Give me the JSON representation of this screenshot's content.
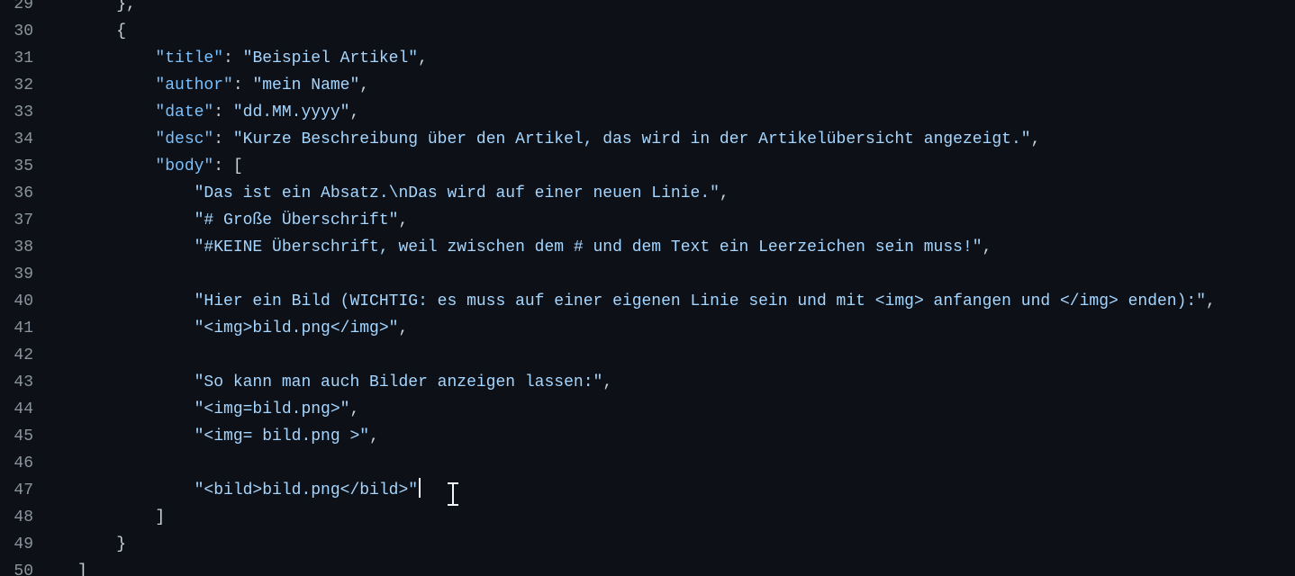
{
  "editor": {
    "lines": [
      {
        "num": "29",
        "pre": "    },",
        "key": "",
        "mid": "",
        "str": "",
        "post": ""
      },
      {
        "num": "30",
        "pre": "    {",
        "key": "",
        "mid": "",
        "str": "",
        "post": ""
      },
      {
        "num": "31",
        "pre": "        ",
        "key": "\"title\"",
        "mid": ": ",
        "str": "\"Beispiel Artikel\"",
        "post": ","
      },
      {
        "num": "32",
        "pre": "        ",
        "key": "\"author\"",
        "mid": ": ",
        "str": "\"mein Name\"",
        "post": ","
      },
      {
        "num": "33",
        "pre": "        ",
        "key": "\"date\"",
        "mid": ": ",
        "str": "\"dd.MM.yyyy\"",
        "post": ","
      },
      {
        "num": "34",
        "pre": "        ",
        "key": "\"desc\"",
        "mid": ": ",
        "str": "\"Kurze Beschreibung über den Artikel, das wird in der Artikelübersicht angezeigt.\"",
        "post": ","
      },
      {
        "num": "35",
        "pre": "        ",
        "key": "\"body\"",
        "mid": ": [",
        "str": "",
        "post": ""
      },
      {
        "num": "36",
        "pre": "            ",
        "key": "",
        "mid": "",
        "str": "\"Das ist ein Absatz.\\nDas wird auf einer neuen Linie.\"",
        "post": ","
      },
      {
        "num": "37",
        "pre": "            ",
        "key": "",
        "mid": "",
        "str": "\"# Große Überschrift\"",
        "post": ","
      },
      {
        "num": "38",
        "pre": "            ",
        "key": "",
        "mid": "",
        "str": "\"#KEINE Überschrift, weil zwischen dem # und dem Text ein Leerzeichen sein muss!\"",
        "post": ","
      },
      {
        "num": "39",
        "pre": "",
        "key": "",
        "mid": "",
        "str": "",
        "post": ""
      },
      {
        "num": "40",
        "pre": "            ",
        "key": "",
        "mid": "",
        "str": "\"Hier ein Bild (WICHTIG: es muss auf einer eigenen Linie sein und mit <img> anfangen und </img> enden):\"",
        "post": ","
      },
      {
        "num": "41",
        "pre": "            ",
        "key": "",
        "mid": "",
        "str": "\"<img>bild.png</img>\"",
        "post": ","
      },
      {
        "num": "42",
        "pre": "",
        "key": "",
        "mid": "",
        "str": "",
        "post": ""
      },
      {
        "num": "43",
        "pre": "            ",
        "key": "",
        "mid": "",
        "str": "\"So kann man auch Bilder anzeigen lassen:\"",
        "post": ","
      },
      {
        "num": "44",
        "pre": "            ",
        "key": "",
        "mid": "",
        "str": "\"<img=bild.png>\"",
        "post": ","
      },
      {
        "num": "45",
        "pre": "            ",
        "key": "",
        "mid": "",
        "str": "\"<img= bild.png >\"",
        "post": ","
      },
      {
        "num": "46",
        "pre": "",
        "key": "",
        "mid": "",
        "str": "",
        "post": ""
      },
      {
        "num": "47",
        "pre": "            ",
        "key": "",
        "mid": "",
        "str": "\"<bild>bild.png</bild>\"",
        "post": "",
        "caret": true
      },
      {
        "num": "48",
        "pre": "        ]",
        "key": "",
        "mid": "",
        "str": "",
        "post": ""
      },
      {
        "num": "49",
        "pre": "    }",
        "key": "",
        "mid": "",
        "str": "",
        "post": ""
      },
      {
        "num": "50",
        "pre": "]",
        "key": "",
        "mid": "",
        "str": "",
        "post": ""
      }
    ],
    "colors": {
      "background": "#0d1117",
      "line_number": "#8b949e",
      "key": "#79c0ff",
      "string": "#a5d6ff",
      "punctuation": "#c9d1d9",
      "caret": "#f0f6fc"
    },
    "pointer_icon": "i-beam-cursor-icon"
  }
}
